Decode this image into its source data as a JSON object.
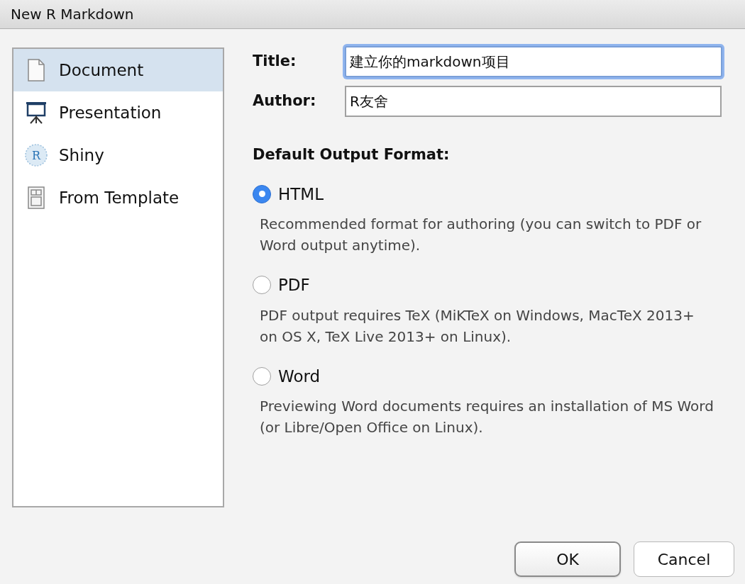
{
  "window": {
    "title": "New R Markdown"
  },
  "sidebar": {
    "items": [
      {
        "label": "Document",
        "kind": "document",
        "selected": true
      },
      {
        "label": "Presentation",
        "kind": "presentation",
        "selected": false
      },
      {
        "label": "Shiny",
        "kind": "shiny",
        "icon_letter": "R",
        "selected": false
      },
      {
        "label": "From Template",
        "kind": "template",
        "selected": false
      }
    ]
  },
  "fields": [
    {
      "label": "Title:",
      "value": "建立你的markdown项目",
      "focused": true
    },
    {
      "label": "Author:",
      "value": "R友舍",
      "focused": false
    }
  ],
  "output_format": {
    "heading": "Default Output Format:",
    "options": [
      {
        "label": "HTML",
        "description": "Recommended format for authoring (you can switch to PDF or Word output anytime).",
        "selected": true
      },
      {
        "label": "PDF",
        "description": "PDF output requires TeX (MiKTeX on Windows, MacTeX 2013+ on OS X, TeX Live 2013+ on Linux).",
        "selected": false
      },
      {
        "label": "Word",
        "description": "Previewing Word documents requires an installation of MS Word (or Libre/Open Office on Linux).",
        "selected": false
      }
    ]
  },
  "buttons": [
    {
      "label": "OK",
      "default": true
    },
    {
      "label": "Cancel",
      "default": false
    }
  ]
}
